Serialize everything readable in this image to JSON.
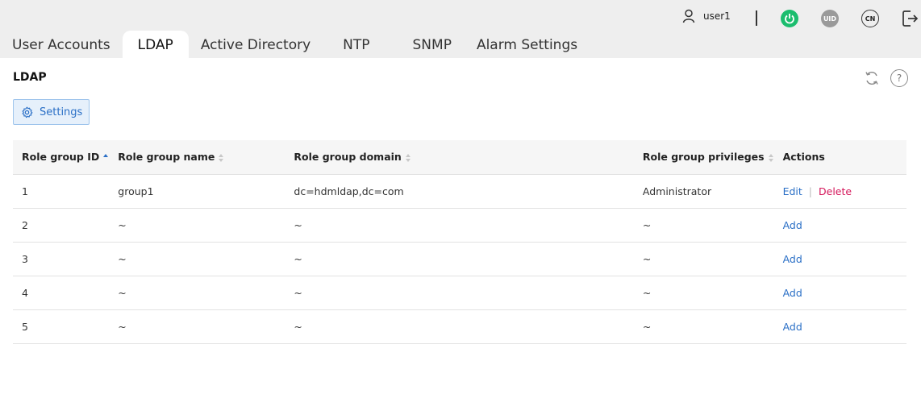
{
  "header": {
    "user": "user1",
    "uid_label": "UID",
    "lang_label": "CN"
  },
  "tabs": [
    {
      "label": "User Accounts",
      "active": false
    },
    {
      "label": "LDAP",
      "active": true
    },
    {
      "label": "Active Directory",
      "active": false
    },
    {
      "label": "NTP",
      "active": false
    },
    {
      "label": "SNMP",
      "active": false
    },
    {
      "label": "Alarm Settings",
      "active": false
    }
  ],
  "panel": {
    "title": "LDAP",
    "help_label": "?",
    "settings_label": "Settings"
  },
  "colors": {
    "accent": "#2a6fc6",
    "power": "#1bbd6e",
    "delete": "#d5175b"
  },
  "table": {
    "columns": [
      "Role group ID",
      "Role group name",
      "Role group domain",
      "Role group privileges",
      "Actions"
    ],
    "rows": [
      {
        "id": "1",
        "name": "group1",
        "domain": "dc=hdmldap,dc=com",
        "privileges": "Administrator",
        "actions": [
          "Edit",
          "Delete"
        ]
      },
      {
        "id": "2",
        "name": "~",
        "domain": "~",
        "privileges": "~",
        "actions": [
          "Add"
        ]
      },
      {
        "id": "3",
        "name": "~",
        "domain": "~",
        "privileges": "~",
        "actions": [
          "Add"
        ]
      },
      {
        "id": "4",
        "name": "~",
        "domain": "~",
        "privileges": "~",
        "actions": [
          "Add"
        ]
      },
      {
        "id": "5",
        "name": "~",
        "domain": "~",
        "privileges": "~",
        "actions": [
          "Add"
        ]
      }
    ]
  }
}
